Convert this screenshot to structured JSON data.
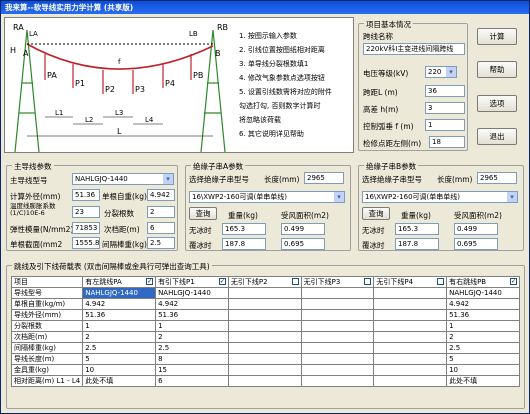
{
  "title": "我来算--软导线实用力学计算 (共享版)",
  "diagram": {
    "labels": {
      "RA": "RA",
      "LA": "LA",
      "H": "H",
      "A": "A",
      "f": "f",
      "LB": "LB",
      "RB": "RB",
      "B": "B",
      "PA": "PA",
      "P1": "P1",
      "P2": "P2",
      "P3": "P3",
      "P4": "P4",
      "PB": "PB",
      "L1": "L1",
      "L2": "L2",
      "L3": "L3",
      "L4": "L4",
      "L": "L"
    },
    "notes": [
      "1. 按图示输入参数",
      "2. 引线位置按图纸相对距离",
      "3. 单导线分裂根数填1",
      "4. 修改气象参数点选项按钮",
      "5. 设置引线数需将对应的附件",
      "   勾选打勾, 否则数字计算时",
      "   将忽略该荷载",
      "6. 其它说明详见帮助"
    ]
  },
  "basic": {
    "group": "项目基本情况",
    "name_label": "跨线名称",
    "name_value": "220kV科I主变进线间隔跨线",
    "voltage_label": "电压等级(kV)",
    "voltage_value": "220",
    "span_label": "跨距L (m)",
    "span_value": "36",
    "height_label": "高差 h(m)",
    "height_value": "3",
    "sag_label": "控制弧垂 f (m)",
    "sag_value": "1",
    "sec_label": "检修点距左侧(m)",
    "sec_value": "18"
  },
  "buttons": {
    "calc": "计算",
    "help": "帮助",
    "options": "选项",
    "exit": "退出",
    "query_a": "查询",
    "query_b": "查询"
  },
  "main": {
    "group": "主导线参数",
    "type_label": "主导线型号",
    "type_value": "NAHLGJQ-1440",
    "od_label": "计算外径(mm)",
    "od_value": "51.36",
    "unit_label": "单根自重(kg)",
    "unit_value": "4.942",
    "temp_label": "温度线膨胀系数(1/C)10E-6",
    "temp_value": "23",
    "split_label": "分裂根数",
    "split_value": "2",
    "mod_label": "弹性模量(N/mm2)",
    "mod_value": "71853",
    "sub_label": "次档距(m)",
    "sub_value": "6",
    "area_label": "单根截面(mm2",
    "area_value": "1555.8",
    "spacer_label": "间隔棒重(kg)",
    "spacer_value": "2.5"
  },
  "insA": {
    "group": "绝缘子串A参数",
    "sel_label": "选择绝缘子串型号",
    "len_label": "长度(mm)",
    "len_value": "2965",
    "type_value": "16\\XWP2-160可调(单串单线)",
    "weight_label": "重量(kg)",
    "wind_label": "受风面积(m2)",
    "noice": "无冰时",
    "w1": "165.3",
    "a1": "0.499",
    "ice": "覆冰时",
    "w2": "187.8",
    "a2": "0.695"
  },
  "insB": {
    "group": "绝缘子串B参数",
    "sel_label": "选择绝缘子串型号",
    "len_label": "长度(mm)",
    "len_value": "2965",
    "type_value": "16\\XWP2-160可调(单串单线)",
    "weight_label": "重量(kg)",
    "wind_label": "受风面积(m2)",
    "noice": "无冰时",
    "w1": "165.3",
    "a1": "0.499",
    "ice": "覆冰时",
    "w2": "187.8",
    "a2": "0.695"
  },
  "grid": {
    "group": "跳线及引下线荷载表 (双击间隔棒或金具行可弹出查询工具)",
    "header": [
      "项目",
      "有左跳线PA",
      "有引下线P1",
      "无引下线P2",
      "无引下线P3",
      "无引下线P4",
      "有右跳线PB"
    ],
    "checks": [
      true,
      true,
      false,
      false,
      false,
      true
    ],
    "rows": [
      [
        "导线型号",
        "NAHLGJQ-1440",
        "NAHLGJQ-1440",
        "",
        "",
        "",
        "NAHLGJQ-1440"
      ],
      [
        "单根自重(kg/m)",
        "4.942",
        "4.942",
        "",
        "",
        "",
        "4.942"
      ],
      [
        "导线外径(mm)",
        "51.36",
        "51.36",
        "",
        "",
        "",
        "51.36"
      ],
      [
        "分裂根数",
        "1",
        "1",
        "",
        "",
        "",
        "1"
      ],
      [
        "次档距(m)",
        "2",
        "2",
        "",
        "",
        "",
        "2"
      ],
      [
        "间隔棒重(kg)",
        "2.5",
        "2.5",
        "",
        "",
        "",
        "2.5"
      ],
      [
        "导线长度(m)",
        "5",
        "8",
        "",
        "",
        "",
        "5"
      ],
      [
        "金具重(kg)",
        "10",
        "15",
        "",
        "",
        "",
        "10"
      ],
      [
        "相对距离(m) L1 - L4",
        "此处不填",
        "6",
        "",
        "",
        "",
        "此处不填"
      ]
    ]
  }
}
